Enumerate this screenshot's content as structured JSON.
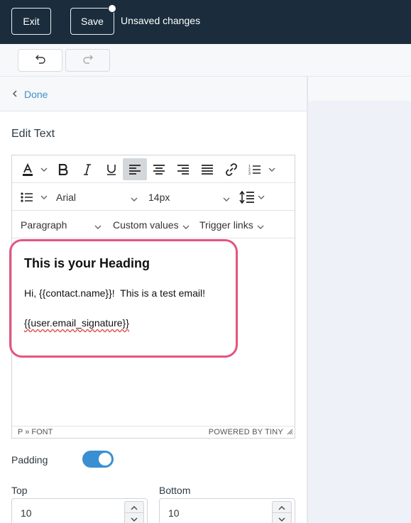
{
  "header": {
    "exit_label": "Exit",
    "save_label": "Save",
    "status_text": "Unsaved changes"
  },
  "panel": {
    "back_label": "Done",
    "title": "Edit Text"
  },
  "editor_toolbar": {
    "font_family": "Arial",
    "font_size": "14px",
    "block_format": "Paragraph",
    "custom_values": "Custom values",
    "trigger_links": "Trigger links"
  },
  "editor_content": {
    "heading": "This is your Heading",
    "greeting": "Hi, {{contact.name}}!  This is a test email!",
    "signature": "{{user.email_signature}}"
  },
  "statusbar": {
    "path": "P » FONT",
    "powered_by": "POWERED BY TINY"
  },
  "padding": {
    "label": "Padding",
    "enabled": true,
    "top_label": "Top",
    "top_value": "10",
    "bottom_label": "Bottom",
    "bottom_value": "10"
  },
  "colors": {
    "header_bg": "#1b2d3c",
    "link": "#3f8fc9",
    "highlight": "#e5547e",
    "toggle_on": "#3a8fd3"
  }
}
